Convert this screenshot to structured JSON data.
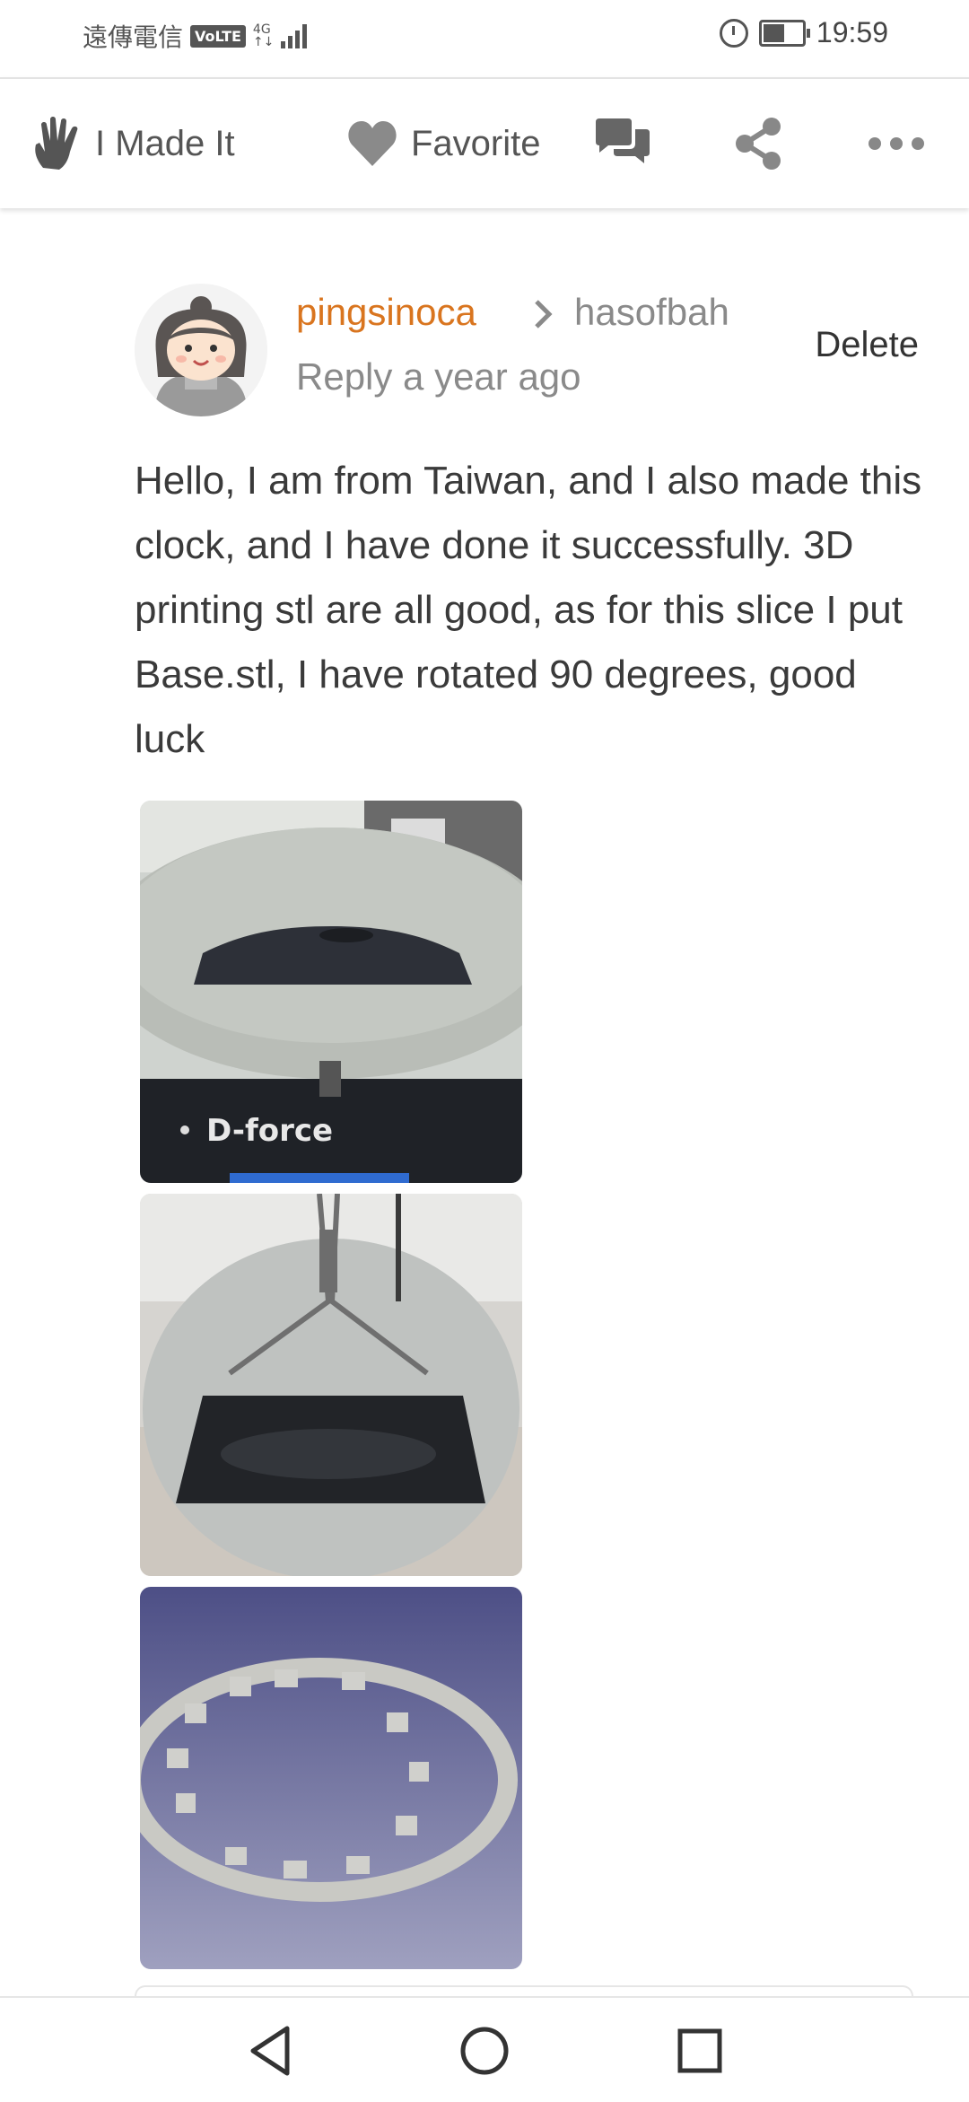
{
  "status_bar": {
    "carrier": "遠傳電信",
    "volte": "VoLTE",
    "network": "4G",
    "network_sub": "↑↓",
    "time": "19:59",
    "battery_level": 0.55
  },
  "action_bar": {
    "made_it_label": "I Made It",
    "favorite_label": "Favorite"
  },
  "comment": {
    "username": "pingsinoca",
    "reply_to": "hasofbah",
    "meta": "Reply a year ago",
    "delete_label": "Delete",
    "text": "Hello, I am from Taiwan, and I also made this clock, and I have done it successfully. 3D printing stl are all good, as for this slice I put Base.stl, I have rotated 90 degrees, good luck",
    "photo1_overlay": "D-force"
  },
  "colors": {
    "username": "#d9751f",
    "muted": "#8a8a8a",
    "text": "#3a3a3a"
  }
}
